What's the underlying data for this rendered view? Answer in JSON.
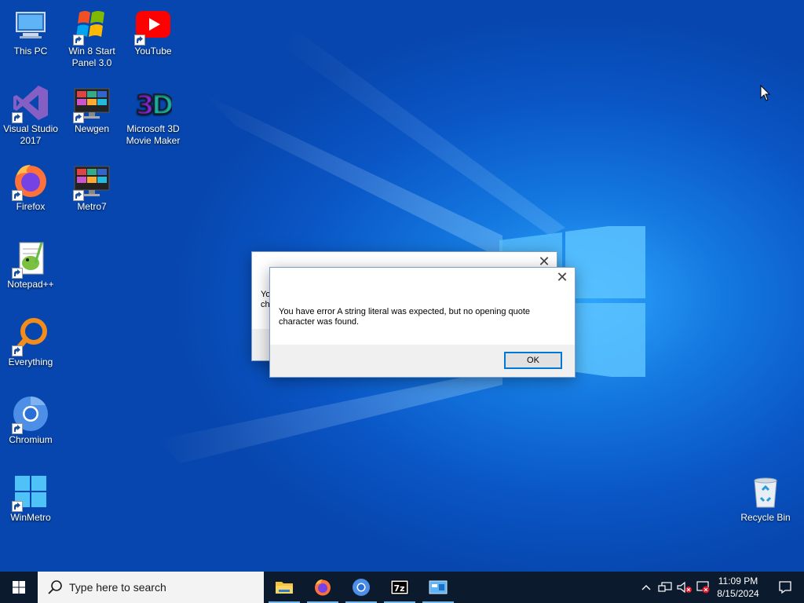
{
  "desktop": {
    "icons": [
      {
        "label": "This PC",
        "icon": "this-pc-icon"
      },
      {
        "label": "Win 8 Start Panel 3.0",
        "icon": "windows-flag-icon"
      },
      {
        "label": "YouTube",
        "icon": "youtube-icon"
      },
      {
        "label": "Visual Studio 2017",
        "icon": "visual-studio-icon"
      },
      {
        "label": "Newgen",
        "icon": "monitor-icon"
      },
      {
        "label": "Microsoft 3D Movie Maker",
        "icon": "3d-icon"
      },
      {
        "label": "Firefox",
        "icon": "firefox-icon"
      },
      {
        "label": "Metro7",
        "icon": "monitor-icon"
      },
      {
        "label": "Notepad++",
        "icon": "notepadpp-icon"
      },
      {
        "label": "Everything",
        "icon": "search-magnifier-icon"
      },
      {
        "label": "Chromium",
        "icon": "chromium-icon"
      },
      {
        "label": "WinMetro",
        "icon": "windows-logo-icon"
      },
      {
        "label": "Recycle Bin",
        "icon": "recycle-bin-icon"
      }
    ]
  },
  "dialog_back": {
    "text_line1": "Yo",
    "text_line2": "ch"
  },
  "dialog_front": {
    "message": "You have error A string literal was expected, but no opening quote character was found.",
    "ok_label": "OK"
  },
  "taskbar": {
    "search_placeholder": "Type here to search",
    "apps": [
      "File Explorer",
      "Firefox",
      "Chromium",
      "7-Zip",
      "Control Panel"
    ],
    "clock_time": "11:09 PM",
    "clock_date": "8/15/2024"
  },
  "colors": {
    "desktop_blue": "#0a56c6",
    "taskbar": "#0c1a2e",
    "accent": "#0078d7"
  }
}
